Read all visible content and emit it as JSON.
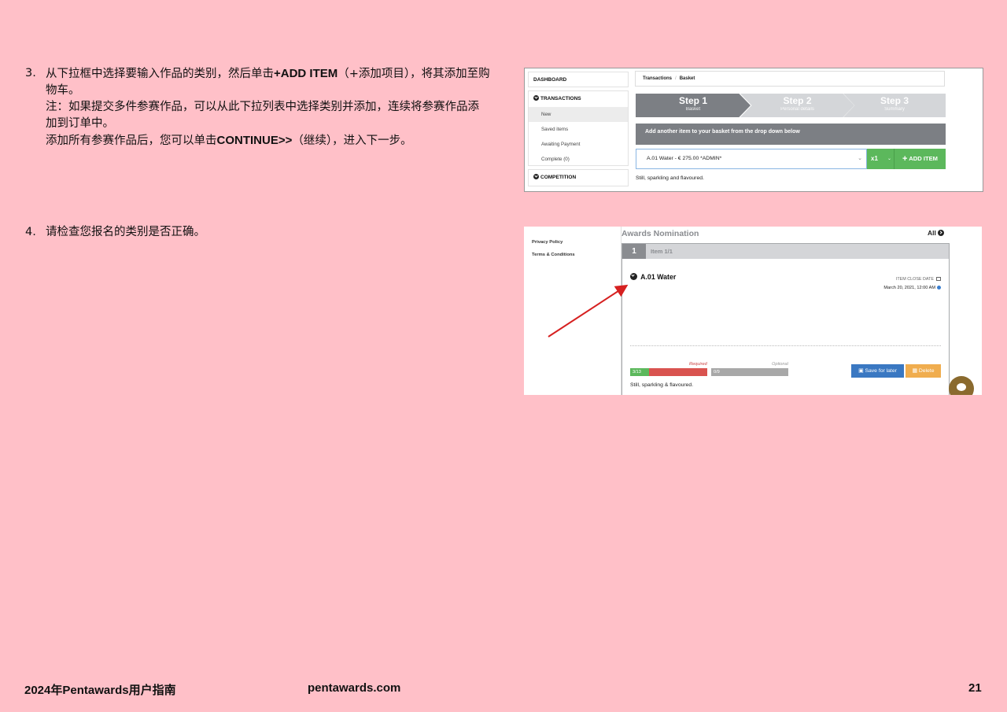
{
  "instructions": {
    "step3": {
      "number": "3.",
      "line1_pre": "从下拉框中选择要输入作品的类别，然后单击",
      "line1_bold": "+ADD ITEM",
      "line1_post": "（+添加项目），将其添加至购",
      "line2": "物车。",
      "line3": "注：如果提交多件参赛作品，可以从此下拉列表中选择类别并添加，连续将参赛作品添",
      "line4": "加到订单中。",
      "line5_pre": "添加所有参赛作品后，您可以单击",
      "line5_bold": "CONTINUE>>",
      "line5_post": "（继续），进入下一步。"
    },
    "step4": {
      "number": "4.",
      "text": "请检查您报名的类别是否正确。"
    }
  },
  "screenshot1": {
    "sidebar": {
      "dashboard": "DASHBOARD",
      "transactions": "TRANSACTIONS",
      "items": [
        "New",
        "Saved items",
        "Awaiting Payment",
        "Complete (0)"
      ],
      "competition": "COMPETITION"
    },
    "breadcrumb": [
      "Transactions",
      "Basket"
    ],
    "steps": [
      {
        "title": "Step 1",
        "subtitle": "Basket"
      },
      {
        "title": "Step 2",
        "subtitle": "Personal details"
      },
      {
        "title": "Step 3",
        "subtitle": "Summary"
      }
    ],
    "banner": "Add another item to your basket from the drop down below",
    "select_value": "A.01 Water  - € 275.00 *ADMIN*",
    "quantity": "x1",
    "add_button": "ADD ITEM",
    "description": "Still, sparkling and flavoured."
  },
  "screenshot2": {
    "sidebar_links": [
      "Privacy Policy",
      "Terms & Conditions"
    ],
    "title": "Awards Nomination",
    "all_label": "All",
    "tab_number": "1",
    "tab_label": "Item 1/1",
    "category": "A.01 Water",
    "close_date_label": "ITEM CLOSE DATE",
    "close_date": "March 20, 2021, 12:00 AM",
    "required_label": "Required",
    "optional_label": "Optional",
    "required_progress": "3/13",
    "optional_progress": "0/9",
    "save_button": "Save for later",
    "delete_button": "Delete",
    "description": "Still, sparkling & flavoured."
  },
  "footer": {
    "guide_title": "2024年Pentawards用户指南",
    "website": "pentawards.com",
    "page_number": "21"
  },
  "colors": {
    "page_background": "#ffc0c8",
    "button_green": "#5cb85c",
    "button_blue": "#3a78c2",
    "button_orange": "#f0ad4e",
    "progress_red": "#d9534f",
    "arrow_red": "#d62020"
  }
}
